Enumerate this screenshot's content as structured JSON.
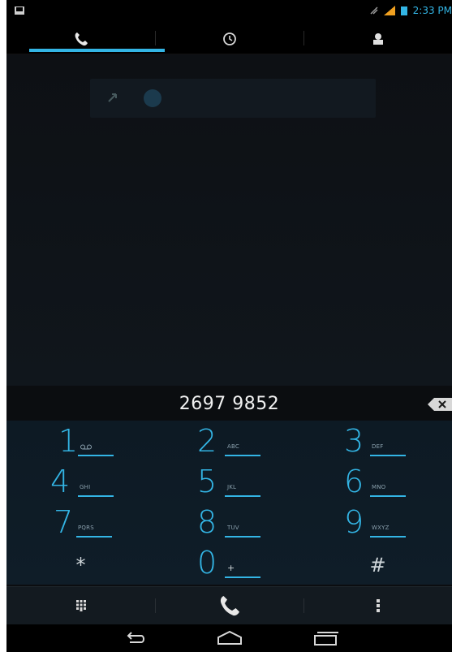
{
  "status_bar": {
    "time": "2:33 PM",
    "icons": [
      "screenshot-icon",
      "vibrate-icon",
      "signal-icon",
      "battery-icon"
    ]
  },
  "tabs": [
    {
      "name": "dialer",
      "icon": "phone-icon",
      "selected": true
    },
    {
      "name": "call-log",
      "icon": "clock-icon",
      "selected": false
    },
    {
      "name": "contacts",
      "icon": "person-icon",
      "selected": false
    }
  ],
  "recent": {
    "icon": "missed-call-icon"
  },
  "dial_display": {
    "number": "2697 9852",
    "delete_icon": "backspace-icon"
  },
  "keypad": [
    {
      "digit": "1",
      "letters": "",
      "extra": "voicemail-icon"
    },
    {
      "digit": "2",
      "letters": "ABC"
    },
    {
      "digit": "3",
      "letters": "DEF"
    },
    {
      "digit": "4",
      "letters": "GHI"
    },
    {
      "digit": "5",
      "letters": "JKL"
    },
    {
      "digit": "6",
      "letters": "MNO"
    },
    {
      "digit": "7",
      "letters": "PQRS"
    },
    {
      "digit": "8",
      "letters": "TUV"
    },
    {
      "digit": "9",
      "letters": "WXYZ"
    },
    {
      "digit": "*",
      "letters": ""
    },
    {
      "digit": "0",
      "letters": "+"
    },
    {
      "digit": "#",
      "letters": ""
    }
  ],
  "action_bar": {
    "left_icon": "dialpad-icon",
    "center_icon": "call-icon",
    "right_icon": "overflow-menu-icon"
  },
  "nav_bar": {
    "icons": [
      "back-icon",
      "home-icon",
      "recent-apps-icon"
    ]
  },
  "colors": {
    "accent": "#33b5e5",
    "background": "#0b0d10",
    "keypad_bg": "#0f1d28"
  }
}
